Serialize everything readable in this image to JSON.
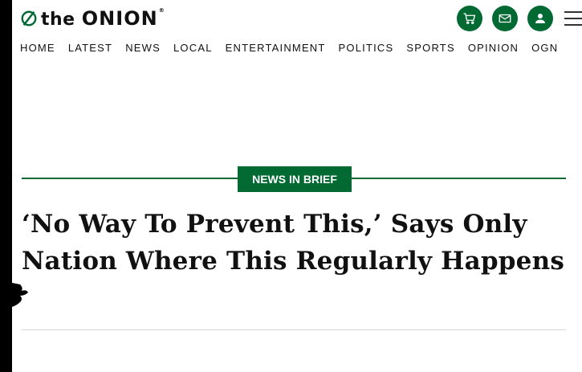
{
  "logo": {
    "the": "the",
    "onion": "ONION",
    "reg": "®"
  },
  "header": {
    "icons": [
      "shopping-cart-icon",
      "envelope-icon",
      "user-icon",
      "hamburger-menu-icon"
    ],
    "accent": "#006a32"
  },
  "nav": {
    "items": [
      {
        "label": "HOME"
      },
      {
        "label": "LATEST"
      },
      {
        "label": "NEWS"
      },
      {
        "label": "LOCAL"
      },
      {
        "label": "ENTERTAINMENT"
      },
      {
        "label": "POLITICS"
      },
      {
        "label": "SPORTS"
      },
      {
        "label": "OPINION"
      },
      {
        "label": "OGN"
      }
    ]
  },
  "article": {
    "category": "NEWS IN BRIEF",
    "headline": "‘No Way To Prevent This,’ Says Only Nation Where This Regularly Happens"
  }
}
